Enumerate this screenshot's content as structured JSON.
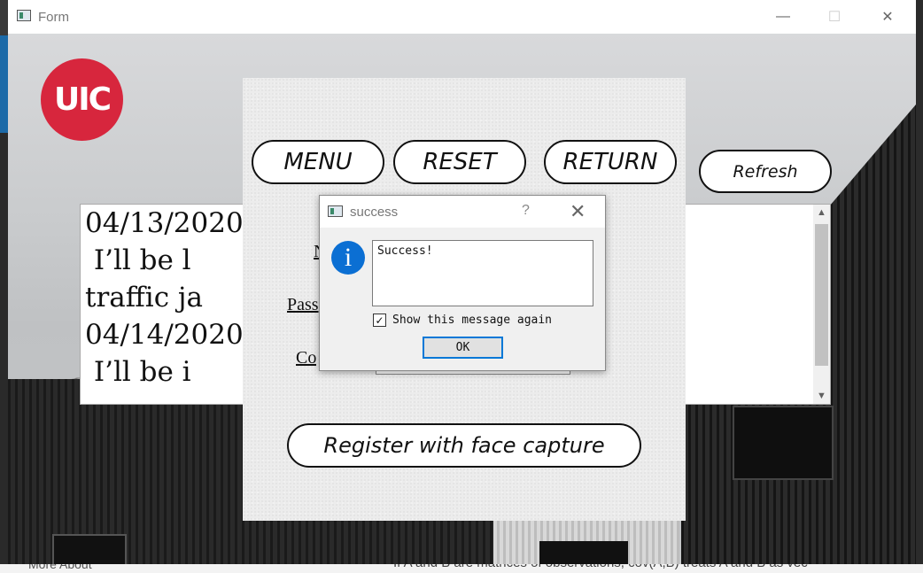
{
  "window": {
    "title": "Form",
    "minimize": "—",
    "maximize": "☐",
    "close": "✕"
  },
  "logo": {
    "text": "UIC"
  },
  "textarea": {
    "lines": [
      "04/13/2020",
      " I’ll be l                  the",
      "traffic ja",
      "04/14/2020",
      " I’ll be i"
    ],
    "scroll_up": "▲",
    "scroll_down": "▼"
  },
  "panel": {
    "menu_label": "MENU",
    "reset_label": "RESET",
    "return_label": "RETURN",
    "field1_label": "N",
    "field2_label": "Pass",
    "field3_label": "Co",
    "register_label": "Register with face capture"
  },
  "refresh_label": "Refresh",
  "dialog": {
    "title": "success",
    "help": "?",
    "close": "✕",
    "icon_glyph": "i",
    "message": "Success!",
    "checkbox_checked": true,
    "checkbox_mark": "✓",
    "checkbox_label": "Show this message again",
    "ok_label": "OK"
  },
  "behind": {
    "left_text": "More About",
    "right_text": "If A and B are matrices of observations, cov(A,B) treats A and B as vec"
  },
  "colors": {
    "logo_red": "#d7263d",
    "info_blue": "#0b6fd3",
    "focus_blue": "#0078d7"
  }
}
